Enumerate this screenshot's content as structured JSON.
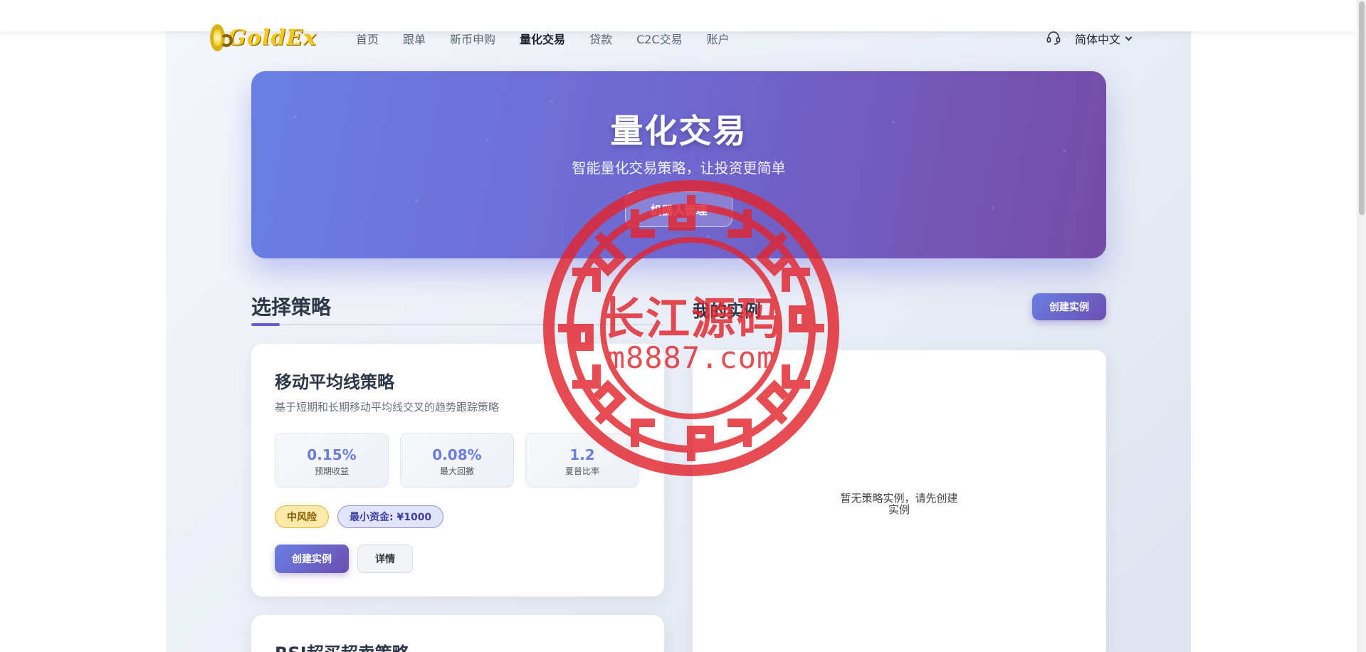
{
  "brand": {
    "logo_text": "GoldEx"
  },
  "nav": {
    "items": [
      {
        "label": "首页"
      },
      {
        "label": "跟单"
      },
      {
        "label": "新币申购"
      },
      {
        "label": "量化交易"
      },
      {
        "label": "贷款"
      },
      {
        "label": "C2C交易"
      },
      {
        "label": "账户"
      }
    ],
    "active": "量化交易"
  },
  "header": {
    "support_icon": "headset-icon",
    "language": "简体中文"
  },
  "hero": {
    "title": "量化交易",
    "subtitle": "智能量化交易策略，让投资更简单",
    "button_label": "机器人管理"
  },
  "strategies": {
    "title": "选择策略",
    "cards": [
      {
        "name": "移动平均线策略",
        "description": "基于短期和长期移动平均线交叉的趋势跟踪策略",
        "metrics": [
          {
            "value": "0.15%",
            "label": "预期收益"
          },
          {
            "value": "0.08%",
            "label": "最大回撤"
          },
          {
            "value": "1.2",
            "label": "夏普比率"
          }
        ],
        "risk_badge": "中风险",
        "min_capital_badge": "最小资金: ¥1000",
        "create_label": "创建实例",
        "details_label": "详情"
      },
      {
        "name": "RSI超买超卖策略"
      }
    ]
  },
  "my_instances": {
    "title": "我的实例",
    "create_label": "创建实例",
    "empty_line1": "暂无策略实例，请先创建",
    "empty_line2": "实例"
  },
  "watermark": {
    "line1": "长江源码",
    "line2": "m8887.com"
  },
  "colors": {
    "accent": "#6a7fe3",
    "accent_dark": "#6b4fb0",
    "risk_badge_bg": "#fde9a9",
    "watermark": "#e2252e"
  }
}
